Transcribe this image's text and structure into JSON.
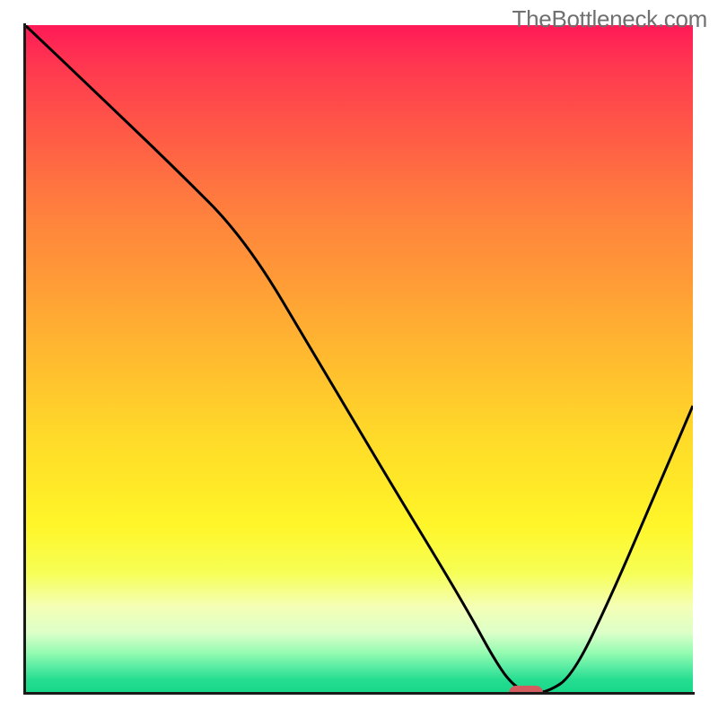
{
  "watermark": "TheBottleneck.com",
  "chart_data": {
    "type": "line",
    "title": "",
    "xlabel": "",
    "ylabel": "",
    "xlim": [
      0,
      100
    ],
    "ylim": [
      0,
      100
    ],
    "grid": false,
    "legend": null,
    "background_gradient_stops": [
      {
        "pct": 0,
        "color": "#ff1a57"
      },
      {
        "pct": 6,
        "color": "#ff3750"
      },
      {
        "pct": 12,
        "color": "#ff4c4a"
      },
      {
        "pct": 19,
        "color": "#ff6344"
      },
      {
        "pct": 25,
        "color": "#ff7740"
      },
      {
        "pct": 31,
        "color": "#ff893b"
      },
      {
        "pct": 38,
        "color": "#ff9a37"
      },
      {
        "pct": 44,
        "color": "#ffab33"
      },
      {
        "pct": 50,
        "color": "#ffbb2f"
      },
      {
        "pct": 56,
        "color": "#ffcb2c"
      },
      {
        "pct": 62,
        "color": "#ffdb29"
      },
      {
        "pct": 69,
        "color": "#ffe927"
      },
      {
        "pct": 75,
        "color": "#fff62a"
      },
      {
        "pct": 82,
        "color": "#f6ff55"
      },
      {
        "pct": 87,
        "color": "#f5ffb5"
      },
      {
        "pct": 91,
        "color": "#dcffc8"
      },
      {
        "pct": 94,
        "color": "#94fbb1"
      },
      {
        "pct": 96.5,
        "color": "#4fe9a0"
      },
      {
        "pct": 98,
        "color": "#26dd90"
      },
      {
        "pct": 100,
        "color": "#17d789"
      }
    ],
    "series": [
      {
        "name": "bottleneck-curve",
        "color": "#000000",
        "stroke_width": 3,
        "x": [
          0,
          10,
          22,
          33,
          44,
          55,
          62,
          67,
          70,
          72.5,
          75,
          78,
          82,
          88,
          94,
          100
        ],
        "y": [
          100,
          90.5,
          79,
          68,
          49.5,
          31,
          19.5,
          11,
          5.5,
          1.7,
          0,
          0,
          2.5,
          15,
          29,
          43
        ]
      }
    ],
    "marker": {
      "name": "optimal-range",
      "color": "#d45c5f",
      "shape": "pill",
      "x_range": [
        72.5,
        77.5
      ],
      "y": 0
    }
  }
}
